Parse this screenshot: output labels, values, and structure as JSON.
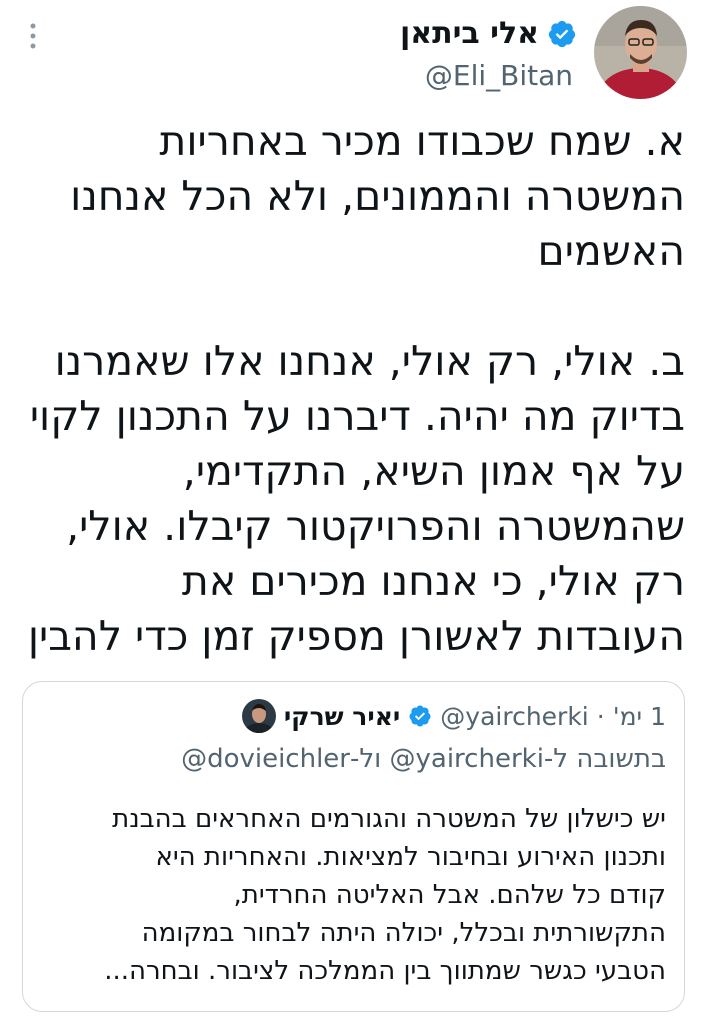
{
  "tweet": {
    "author_name": "אלי ביתאן",
    "handle": "@Eli_Bitan",
    "text": "א. שמח שכבודו מכיר באחריות\nהמשטרה והממונים, ולא הכל אנחנו\nהאשמים\n\nב. אולי, רק אולי, אנחנו אלו שאמרנו\nבדיוק מה יהיה. דיברנו על התכנון לקוי\nעל אף אמון השיא, התקדימי,\nשהמשטרה והפרויקטור קיבלו. אולי,\nרק אולי, כי אנחנו מכירים את\nהעובדות לאשורן מספיק זמן כדי להבין"
  },
  "quoted_tweet": {
    "author_name": "יאיר שרקי",
    "handle": "@yaircherki",
    "separator": "·",
    "time": "1 ימ'",
    "reply_prefix": "בתשובה ל-",
    "reply_mention_1": "@yaircherki",
    "reply_joiner": " ול-",
    "reply_mention_2": "@dovieichler",
    "text": "יש כישלון של המשטרה והגורמים האחראים בהבנת\nותכנון האירוע ובחיבור למציאות. והאחריות היא\nקודם כל שלהם. אבל האליטה החרדית,\nהתקשורתית ובכלל, יכולה היתה לבחור במקומה\nהטבעי כגשר שמתווך בין הממלכה לציבור. ובחרה..."
  },
  "icons": {
    "verified": "verified-badge-icon",
    "more": "more-options-icon"
  },
  "colors": {
    "verified_blue": "#1d9bf0",
    "text_primary": "#0f1419",
    "text_secondary": "#536471",
    "border": "#cfd9de"
  }
}
